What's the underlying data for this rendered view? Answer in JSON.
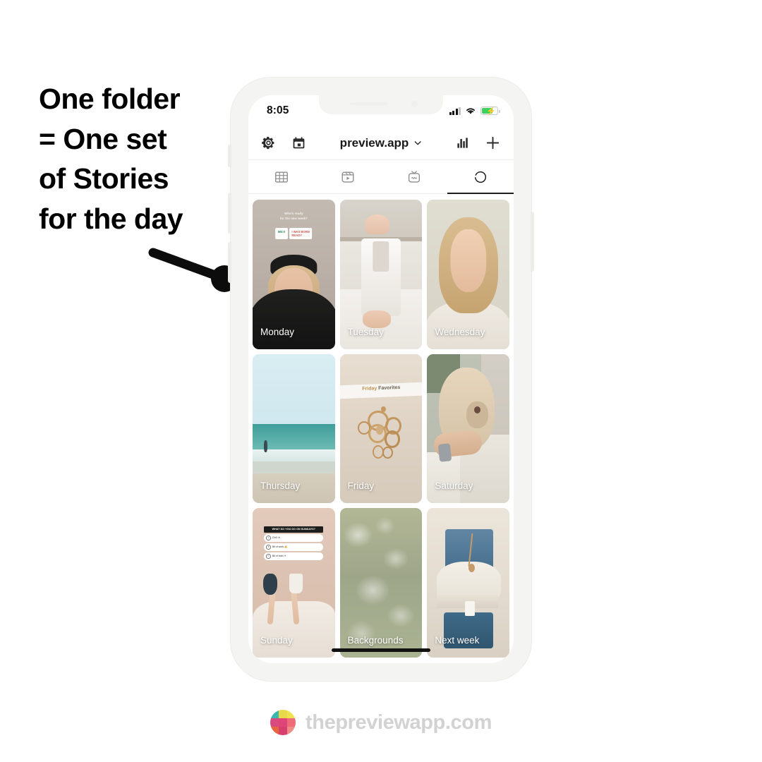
{
  "headline": {
    "line1": "One folder",
    "line2": "= One set",
    "line3": "of Stories",
    "line4": "for the day"
  },
  "phone": {
    "status_bar": {
      "time": "8:05",
      "signal_icon": "signal-bars-icon",
      "wifi_icon": "wifi-icon",
      "battery_icon": "battery-charging-icon"
    },
    "toolbar": {
      "settings_icon": "gear-icon",
      "calendar_icon": "calendar-icon",
      "title": "preview.app",
      "chevron_icon": "chevron-down-icon",
      "analytics_icon": "bar-chart-icon",
      "add_icon": "plus-icon"
    },
    "tabs": [
      {
        "name": "grid",
        "icon": "grid-icon",
        "active": false
      },
      {
        "name": "reels",
        "icon": "reels-icon",
        "active": false
      },
      {
        "name": "igtv",
        "icon": "igtv-icon",
        "active": false
      },
      {
        "name": "stories",
        "icon": "stories-circle-icon",
        "active": true
      }
    ],
    "grid": [
      {
        "label": "Monday",
        "overlay_text_line1": "Who's ready",
        "overlay_text_line2": "for the new week?",
        "sticker1": "ME!!!",
        "sticker2_line1": "I WAS BORN",
        "sticker2_line2": "READY"
      },
      {
        "label": "Tuesday"
      },
      {
        "label": "Wednesday"
      },
      {
        "label": "Thursday"
      },
      {
        "label": "Friday",
        "overlay_text_a": "Friday ",
        "overlay_text_b": "Favorites"
      },
      {
        "label": "Saturday"
      },
      {
        "label": "Sunday",
        "quiz_title": "WHAT DO YOU DO ON SUNDAYS?",
        "quiz_options": [
          {
            "key": "A",
            "text": "Chill ☕"
          },
          {
            "key": "B",
            "text": "Bit of work ✍"
          },
          {
            "key": "C",
            "text": "Bit of both ☀"
          }
        ]
      },
      {
        "label": "Backgrounds"
      },
      {
        "label": "Next week"
      }
    ]
  },
  "footer": {
    "brand": "thepreviewapp.com",
    "logo_icon": "preview-grid-logo-icon",
    "logo_colors": [
      "#3bb8ae",
      "#e8d84a",
      "#f0e24f",
      "#d94b7f",
      "#e0457a",
      "#ef6b7a",
      "#e8663f",
      "#d63f6e",
      "#f08a85"
    ]
  },
  "colors": {
    "accent": "#1c1c1c",
    "battery_green": "#3cd25b",
    "footer_text": "#d2d2d2"
  }
}
